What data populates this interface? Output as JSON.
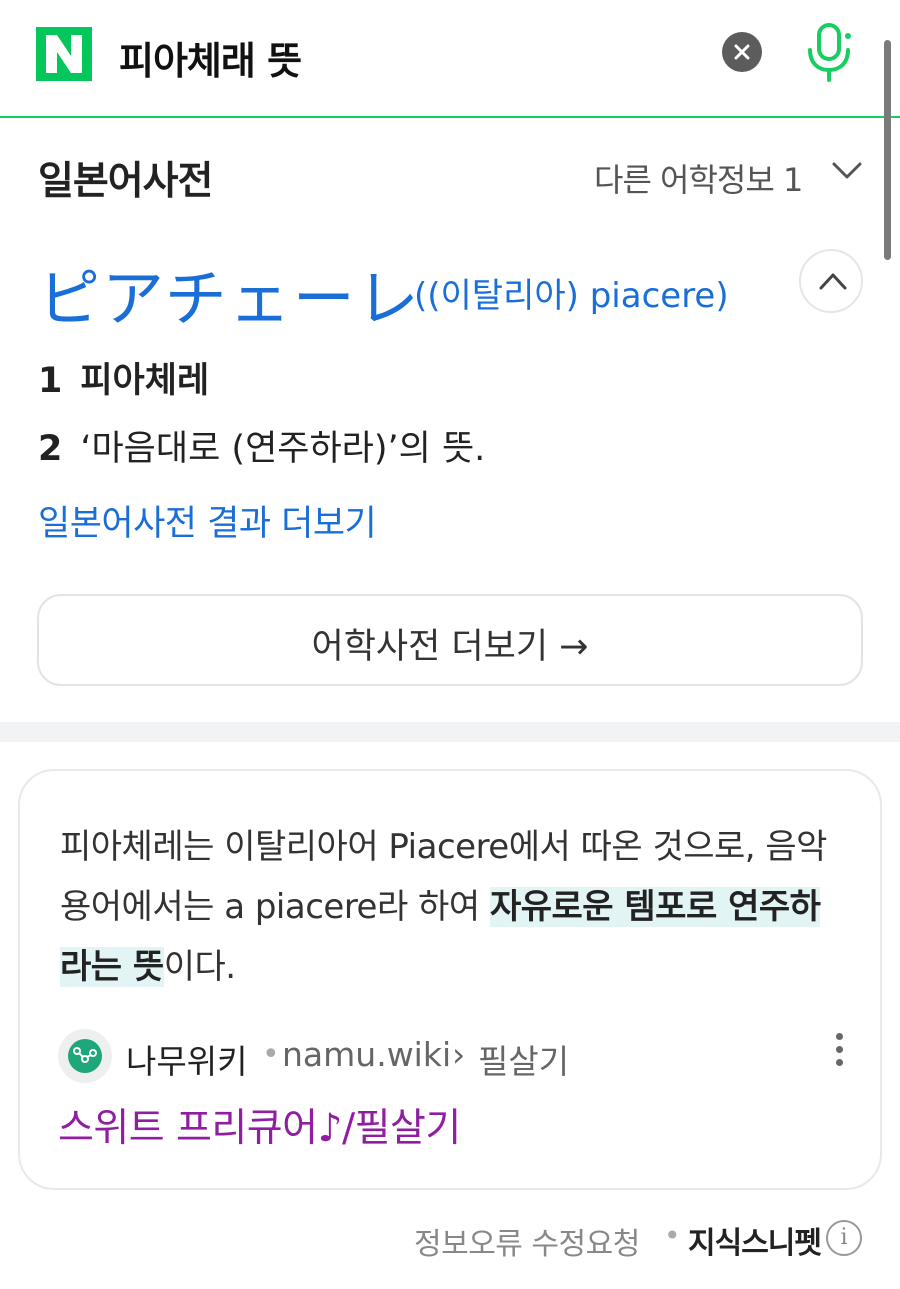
{
  "search": {
    "query": "피아체래 뜻",
    "logo_letter": "N",
    "brand_color": "#03c75a"
  },
  "dictionary": {
    "title": "일본어사전",
    "other_info_label": "다른 어학정보 1",
    "headword": "ピアチェーレ",
    "origin": "((이탈리아) piacere)",
    "meanings": [
      {
        "num": "1",
        "text": "피아체레"
      },
      {
        "num": "2",
        "text": "‘마음대로 (연주하라)’의 뜻."
      }
    ],
    "more_results_link": "일본어사전 결과 더보기",
    "lang_more_button": "어학사전 더보기 →"
  },
  "snippet": {
    "text_before": "피아체레는 이탈리아어 Piacere에서 따온 것으로, 음악용어에서는 a piacere라 하여 ",
    "text_highlight": "자유로운 템포로 연주하라는 뜻",
    "text_after": "이다.",
    "source_name": "나무위키",
    "source_url": "namu.wiki",
    "source_path_sep": "›",
    "source_path": "필살기",
    "doc_title": "스위트 프리큐어♪/필살기"
  },
  "footer": {
    "report_label": "정보오류 수정요청",
    "dot": "•",
    "brand_label": "지식스니펫",
    "info_icon": "i"
  },
  "colors": {
    "link_blue": "#1a6ed8",
    "visited_purple": "#8f1fa0",
    "highlight_bg": "#e3f4f4"
  }
}
